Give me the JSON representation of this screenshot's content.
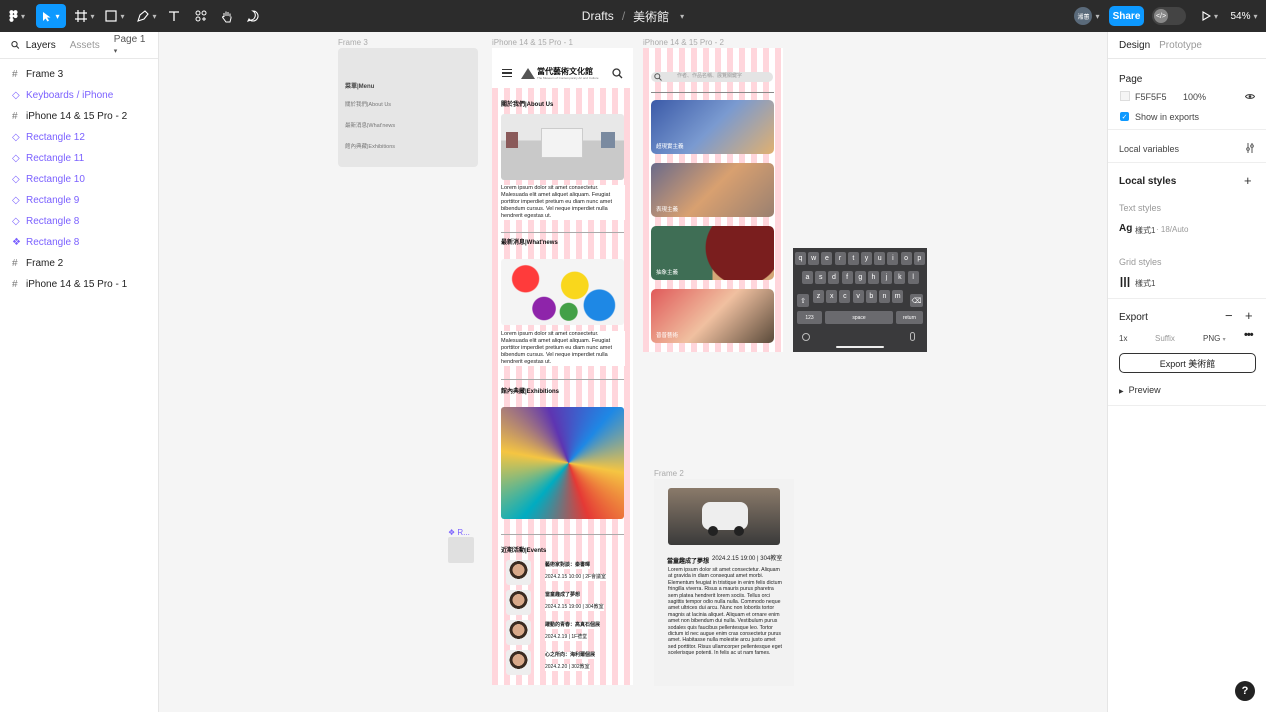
{
  "topbar": {
    "file_path": "Drafts",
    "file_sep": "/",
    "file_name": "美術館",
    "user_badge": "湘蕙",
    "share_label": "Share",
    "zoom": "54%"
  },
  "left_panel": {
    "tabs": [
      "Layers",
      "Assets"
    ],
    "page_label": "Page 1",
    "layers": [
      {
        "name": "Frame 3",
        "type": "frame"
      },
      {
        "name": "Keyboards / iPhone",
        "type": "component"
      },
      {
        "name": "iPhone 14 & 15 Pro - 2",
        "type": "frame"
      },
      {
        "name": "Rectangle 12",
        "type": "component"
      },
      {
        "name": "Rectangle 11",
        "type": "component"
      },
      {
        "name": "Rectangle 10",
        "type": "component"
      },
      {
        "name": "Rectangle 9",
        "type": "component"
      },
      {
        "name": "Rectangle 8",
        "type": "component"
      },
      {
        "name": "Rectangle 8",
        "type": "main-component"
      },
      {
        "name": "Frame 2",
        "type": "frame"
      },
      {
        "name": "iPhone 14 & 15 Pro - 1",
        "type": "frame"
      }
    ]
  },
  "right_panel": {
    "tabs": [
      "Design",
      "Prototype"
    ],
    "page_section": "Page",
    "page_color": "F5F5F5",
    "page_opacity": "100%",
    "show_in_exports": "Show in exports",
    "local_variables": "Local variables",
    "local_styles": "Local styles",
    "text_styles_label": "Text styles",
    "text_style_name": "樣式1",
    "text_style_meta": "· 18/Auto",
    "grid_styles_label": "Grid styles",
    "grid_style_name": "樣式1",
    "export_label": "Export",
    "export_scale": "1x",
    "export_suffix_placeholder": "Suffix",
    "export_format": "PNG",
    "export_button": "Export 美術館",
    "preview_label": "Preview"
  },
  "canvas": {
    "frame_labels": {
      "frame3": "Frame 3",
      "iphone1": "iPhone 14 & 15 Pro - 1",
      "iphone2": "iPhone 14 & 15 Pro - 2",
      "frame2": "Frame 2",
      "rect_label": "R..."
    },
    "menu": {
      "title": "菜單|Menu",
      "items": [
        "關於我們|About Us",
        "最新消息|What'news",
        "館內典藏|Exhibitions"
      ]
    },
    "iphone1": {
      "logo": "當代藝術文化館",
      "logo_sub": "The Museum of Contemporary Art and Culture",
      "about_title": "關於我們|About Us",
      "lorem": "Lorem ipsum dolor sit amet consectetur. Malesuada elit amet aliquet aliquam. Feugiat porttitor imperdiet pretium eu diam nunc amet bibendum cursus. Vel neque imperdiet nulla hendrerit egestas ut.",
      "news_title": "最新消息|What'news",
      "exhibit_title": "館內典藏|Exhibitions",
      "events_title": "近期活動|Events",
      "events": [
        {
          "title": "藝術家對談：秦書暉",
          "time": "2024.2.15 10:00 | 2F會議室"
        },
        {
          "title": "當童趣成了夢想",
          "time": "2024.2.15 19:00 | 304教室"
        },
        {
          "title": "躍動的青春：高真石個展",
          "time": "2024.2.19 | 1F禮堂"
        },
        {
          "title": "心之所向：海利爾個展",
          "time": "2024.2.20 | 302教室"
        }
      ]
    },
    "iphone2": {
      "search_placeholder": "作者、作品名稱、展覽關鍵字",
      "cards": [
        "超現實主義",
        "表現主義",
        "抽象主義",
        "普普藝術"
      ]
    },
    "frame2": {
      "title": "當童趣成了夢想",
      "time": "2024.2.15 19:00 | 304教室",
      "body": "Lorem ipsum dolor sit amet consectetur. Aliquam at gravida in diam consequat amet morbi. Elementum feugiat in tristique in enim felis dictum fringilla viverra. Risus a mauris purus pharetra sem platea hendrerit lorem sociis. Tellus orci sagittis tempor odio nulla nulla. Commodo neque amet ultrices dui arcu. Nunc non lobortis tortor magnis at lacinia aliquet. Aliquam et ornare enim amet non bibendum dui nulla. Vestibulum purus sodales quis faucibus pellentesque leo. Tortor dictum id nec augue enim cras consectetur purus amet. Habitasse nulla molestie arcu justo amet sed porttitor. Risus ullamcorper pellentesque eget scelerisque potenti. In felis ac ut nam fames."
    },
    "keyboard": {
      "row1": [
        "q",
        "w",
        "e",
        "r",
        "t",
        "y",
        "u",
        "i",
        "o",
        "p"
      ],
      "row2": [
        "a",
        "s",
        "d",
        "f",
        "g",
        "h",
        "j",
        "k",
        "l"
      ],
      "row3": [
        "z",
        "x",
        "c",
        "v",
        "b",
        "n",
        "m"
      ],
      "num": "123",
      "space": "space",
      "return": "return"
    }
  },
  "help": "?"
}
